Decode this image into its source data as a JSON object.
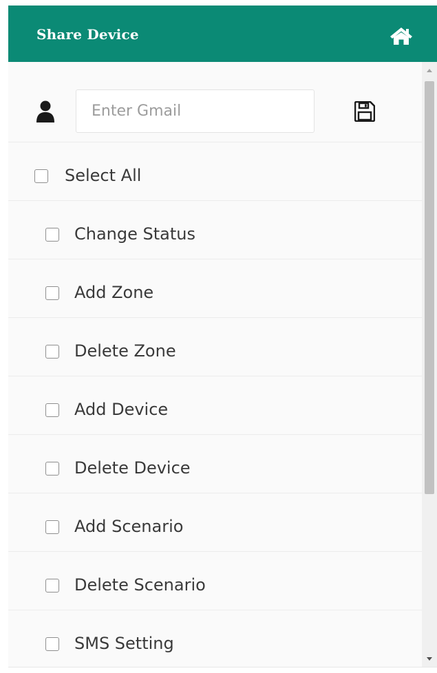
{
  "header": {
    "title": "Share Device",
    "home_icon": "home-icon",
    "background_color": "#0b8a75"
  },
  "share_form": {
    "user_icon": "user-icon",
    "email_placeholder": "Enter Gmail",
    "email_value": "",
    "save_icon": "floppy-disk-icon"
  },
  "select_all": {
    "label": "Select All",
    "checked": false
  },
  "permissions": [
    {
      "label": "Change Status",
      "checked": false
    },
    {
      "label": "Add Zone",
      "checked": false
    },
    {
      "label": "Delete Zone",
      "checked": false
    },
    {
      "label": "Add Device",
      "checked": false
    },
    {
      "label": "Delete Device",
      "checked": false
    },
    {
      "label": "Add Scenario",
      "checked": false
    },
    {
      "label": "Delete Scenario",
      "checked": false
    },
    {
      "label": "SMS Setting",
      "checked": false
    }
  ]
}
